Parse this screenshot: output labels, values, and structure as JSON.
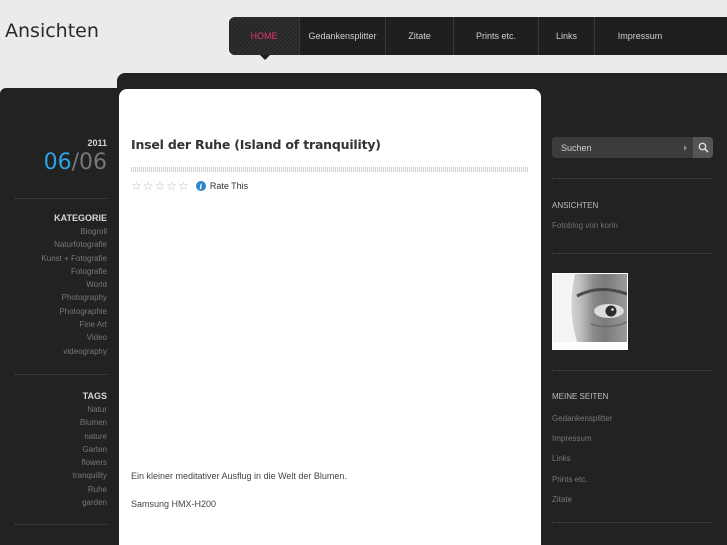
{
  "site": {
    "title": "Ansichten"
  },
  "nav": {
    "items": [
      {
        "label": "HOME"
      },
      {
        "label": "Gedankensplitter"
      },
      {
        "label": "Zitate"
      },
      {
        "label": "Prints etc."
      },
      {
        "label": "Links"
      },
      {
        "label": "Impressum"
      }
    ]
  },
  "post": {
    "date": {
      "year": "2011",
      "month": "06",
      "separator": "/",
      "day": "06"
    },
    "title": "Insel der Ruhe (Island of tranquility)",
    "rate_label": "Rate This",
    "paragraphs": [
      "Ein kleiner meditativer Ausflug in die Welt der Blumen.",
      "Samsung HMX-H200"
    ]
  },
  "left_sidebar": {
    "categories": {
      "heading": "KATEGORIE",
      "items": [
        "Blogroll",
        "Naturfotografie",
        "Kunst + Fotografie",
        "Fotografie",
        "World",
        "Photography",
        "Photographie",
        "Fine Art",
        "Video",
        "videography"
      ]
    },
    "tags": {
      "heading": "TAGS",
      "items": [
        "Natur",
        "Blumen",
        "nature",
        "Garten",
        "flowers",
        "tranquility",
        "Ruhe",
        "garden"
      ]
    }
  },
  "right_sidebar": {
    "search": {
      "placeholder": "Suchen"
    },
    "about": {
      "heading": "ANSICHTEN",
      "text": "Fotoblog von korin"
    },
    "pages": {
      "heading": "MEINE SEITEN",
      "items": [
        "Gedankensplitter",
        "Impressum",
        "Links",
        "Prints etc.",
        "Zitate"
      ]
    }
  },
  "colors": {
    "accent": "#2ea3e3",
    "nav_active": "#e8336b",
    "frame": "#222222"
  }
}
